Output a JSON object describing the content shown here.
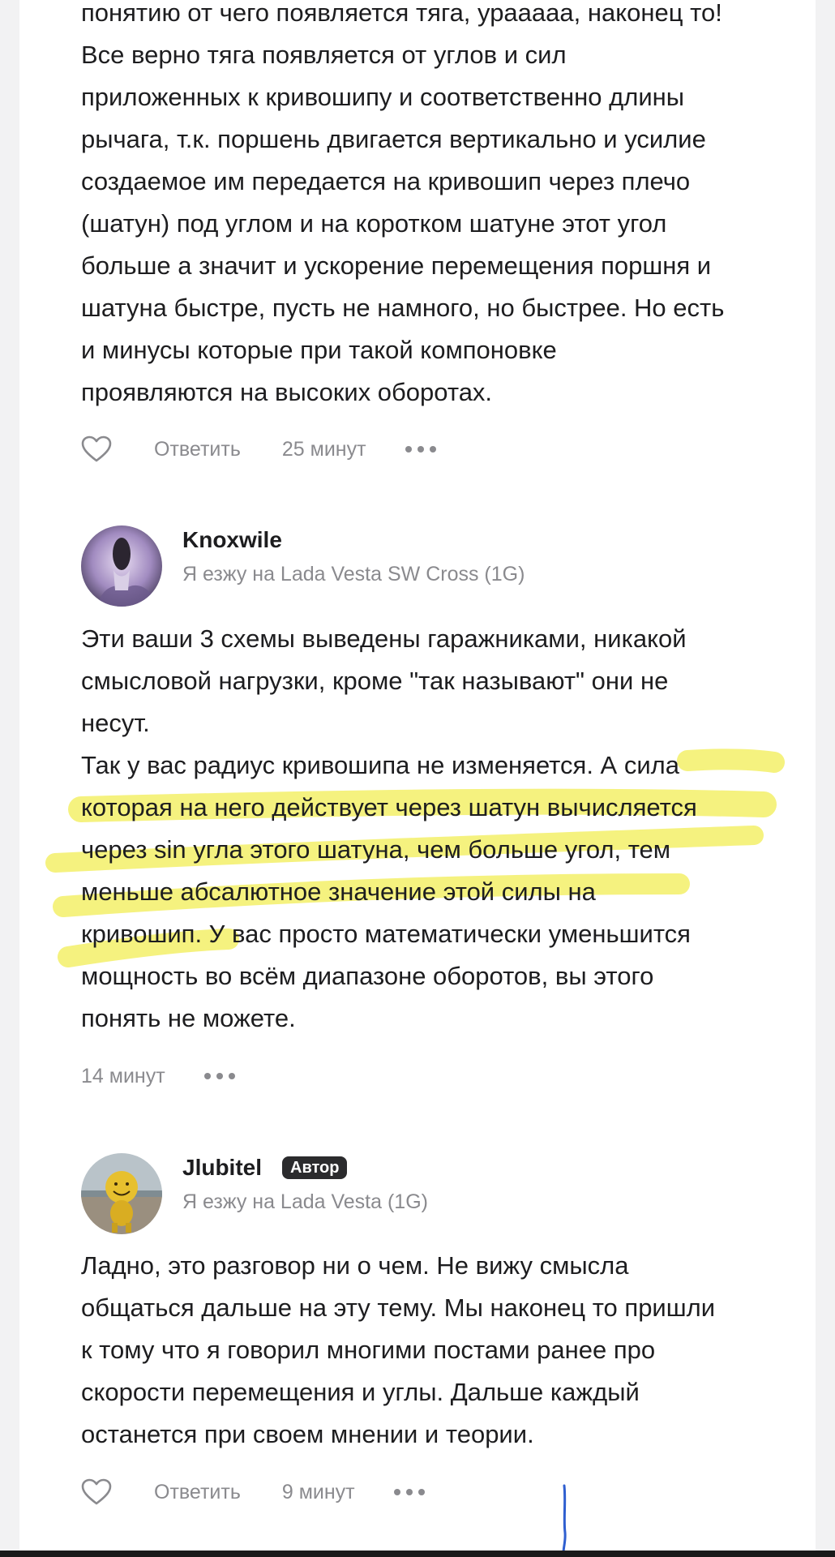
{
  "comment_top": {
    "lines": [
      "понятию от чего появляется тяга, урааааа, наконец то!",
      "Все верно тяга появляется от углов и сил",
      "приложенных к кривошипу и соответственно длины",
      "рычага, т.к. поршень двигается вертикально и усилие",
      "создаемое им передается на кривошип через плечо",
      "(шатун) под углом и на коротком шатуне этот угол",
      "больше а значит и ускорение перемещения поршня и",
      "шатуна быстре, пусть не намного, но быстрее. Но есть",
      "и минусы которые при такой компоновке",
      "проявляются на высоких оборотах."
    ],
    "reply_label": "Ответить",
    "time": "25 минут"
  },
  "comment_knoxwile": {
    "author": "Knoxwile",
    "car": "Я езжу на Lada Vesta SW Cross (1G)",
    "lines": [
      "Эти ваши 3 схемы выведены гаражниками, никакой",
      "смысловой нагрузки, кроме \"так называют\" они не",
      "несут.",
      "Так у вас радиус кривошипа не изменяется. А сила",
      "которая на него действует через шатун вычисляется",
      "через sin угла этого шатуна, чем больше угол, тем",
      "меньше абсалютное значение этой силы на",
      "кривошип. У вас просто математически уменьшится",
      "мощность во всём диапазоне оборотов, вы этого",
      "понять не можете."
    ],
    "time": "14 минут"
  },
  "comment_jlubitel": {
    "author": "Jlubitel",
    "badge": "Автор",
    "car": "Я езжу на Lada Vesta (1G)",
    "lines": [
      "Ладно, это разговор ни о чем. Не вижу смысла",
      "общаться дальше на эту тему. Мы наконец то пришли",
      "к тому что я говорил многими постами ранее про",
      "скорости перемещения и углы. Дальше каждый",
      "останется при своем мнении и теории."
    ],
    "reply_label": "Ответить",
    "time": "9 минут"
  },
  "colors": {
    "highlight": "#f3f069",
    "text": "#1d1d1f",
    "muted": "#8a8a8e",
    "badge_bg": "#2b2b2d",
    "pen_stroke": "#2f5fd0"
  }
}
